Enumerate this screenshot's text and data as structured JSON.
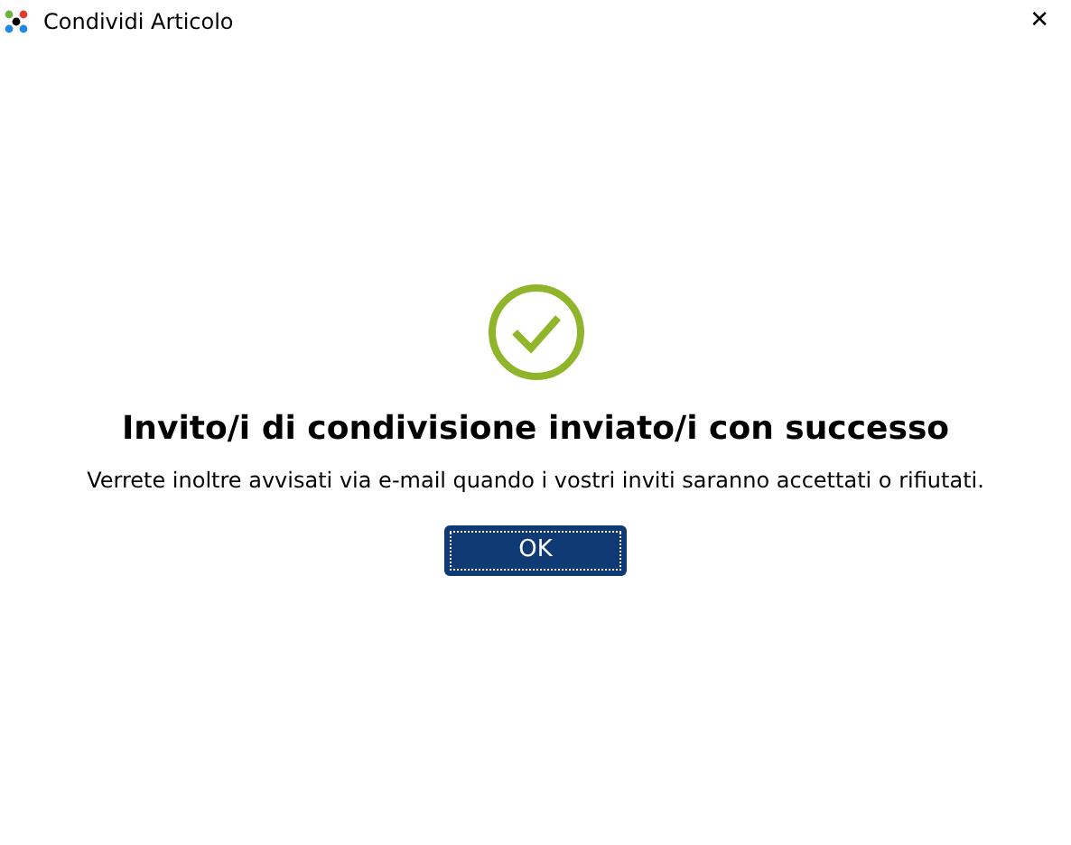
{
  "window": {
    "title": "Condividi Articolo",
    "close": "✕"
  },
  "message": {
    "title": "Invito/i di condivisione inviato/i con successo",
    "text": "Verrete inoltre avvisati via e-mail quando i vostri inviti saranno accettati o rifiutati."
  },
  "buttons": [
    {
      "label": "OK",
      "focused": true
    }
  ]
}
